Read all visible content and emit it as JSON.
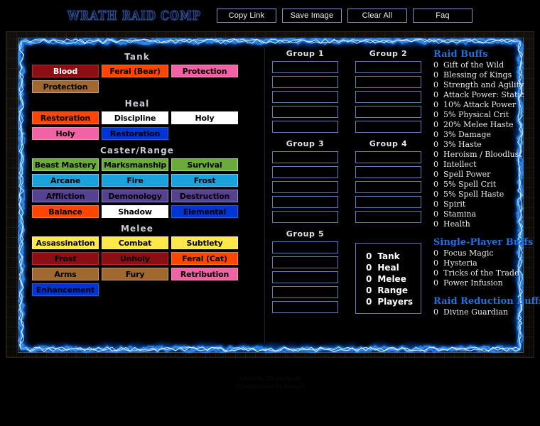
{
  "app": {
    "title": "WRATH RAID COMP",
    "accent_blue": "#1f6fe0",
    "border_blue": "#5f7fb5",
    "frame_gold": "#6b4f21"
  },
  "toolbar": {
    "buttons": [
      {
        "label": "Copy Link",
        "name": "copy-link-button"
      },
      {
        "label": "Save Image",
        "name": "save-image-button"
      },
      {
        "label": "Clear All",
        "name": "clear-all-button"
      },
      {
        "label": "Faq",
        "name": "faq-button"
      }
    ]
  },
  "specs": {
    "categories": [
      {
        "title": "Tank",
        "rows": [
          [
            {
              "label": "Blood",
              "bg": "#8b0f12",
              "fg": "#ffffff",
              "border": "#c41f3b"
            },
            {
              "label": "Feral (Bear)",
              "bg": "#ff4500",
              "fg": "#000000",
              "border": "#ff7d0a"
            },
            {
              "label": "Protection",
              "bg": "#f263a6",
              "fg": "#000000",
              "border": "#f58cba"
            }
          ],
          [
            {
              "label": "Protection",
              "bg": "#a0682f",
              "fg": "#000000",
              "border": "#c79c6e"
            }
          ]
        ]
      },
      {
        "title": "Heal",
        "rows": [
          [
            {
              "label": "Restoration",
              "bg": "#ff4500",
              "fg": "#000000",
              "border": "#ff7d0a"
            },
            {
              "label": "Discipline",
              "bg": "#ffffff",
              "fg": "#000000",
              "border": "#ffffff"
            },
            {
              "label": "Holy",
              "bg": "#ffffff",
              "fg": "#000000",
              "border": "#ffffff"
            }
          ],
          [
            {
              "label": "Holy",
              "bg": "#f263a6",
              "fg": "#000000",
              "border": "#f58cba"
            },
            {
              "label": "Restoration",
              "bg": "#0034d6",
              "fg": "#000000",
              "border": "#0070de"
            }
          ]
        ]
      },
      {
        "title": "Caster/Range",
        "rows": [
          [
            {
              "label": "Beast Mastery",
              "bg": "#6bab3c",
              "fg": "#000000",
              "border": "#abd473"
            },
            {
              "label": "Marksmanship",
              "bg": "#6bab3c",
              "fg": "#000000",
              "border": "#abd473"
            },
            {
              "label": "Survival",
              "bg": "#6bab3c",
              "fg": "#000000",
              "border": "#abd473"
            }
          ],
          [
            {
              "label": "Arcane",
              "bg": "#1ba1dd",
              "fg": "#000000",
              "border": "#69ccf0"
            },
            {
              "label": "Fire",
              "bg": "#1ba1dd",
              "fg": "#000000",
              "border": "#69ccf0"
            },
            {
              "label": "Frost",
              "bg": "#1ba1dd",
              "fg": "#000000",
              "border": "#69ccf0"
            }
          ],
          [
            {
              "label": "Affliction",
              "bg": "#55418f",
              "fg": "#000000",
              "border": "#9482c9"
            },
            {
              "label": "Demonology",
              "bg": "#55418f",
              "fg": "#000000",
              "border": "#9482c9"
            },
            {
              "label": "Destruction",
              "bg": "#55418f",
              "fg": "#000000",
              "border": "#9482c9"
            }
          ],
          [
            {
              "label": "Balance",
              "bg": "#ff4500",
              "fg": "#000000",
              "border": "#ff7d0a"
            },
            {
              "label": "Shadow",
              "bg": "#ffffff",
              "fg": "#000000",
              "border": "#ffffff"
            },
            {
              "label": "Elemental",
              "bg": "#0034d6",
              "fg": "#000000",
              "border": "#0070de"
            }
          ]
        ]
      },
      {
        "title": "Melee",
        "rows": [
          [
            {
              "label": "Assassination",
              "bg": "#ffe84a",
              "fg": "#000000",
              "border": "#fff569"
            },
            {
              "label": "Combat",
              "bg": "#ffe84a",
              "fg": "#000000",
              "border": "#fff569"
            },
            {
              "label": "Subtlety",
              "bg": "#ffe84a",
              "fg": "#000000",
              "border": "#fff569"
            }
          ],
          [
            {
              "label": "Frost",
              "bg": "#8b0f12",
              "fg": "#000000",
              "border": "#c41f3b"
            },
            {
              "label": "Unholy",
              "bg": "#8b0f12",
              "fg": "#000000",
              "border": "#c41f3b"
            },
            {
              "label": "Feral (Cat)",
              "bg": "#ff4500",
              "fg": "#000000",
              "border": "#ff7d0a"
            }
          ],
          [
            {
              "label": "Arms",
              "bg": "#a0682f",
              "fg": "#000000",
              "border": "#c79c6e"
            },
            {
              "label": "Fury",
              "bg": "#a0682f",
              "fg": "#000000",
              "border": "#c79c6e"
            },
            {
              "label": "Retribution",
              "bg": "#f263a6",
              "fg": "#000000",
              "border": "#f58cba"
            }
          ],
          [
            {
              "label": "Enhancement",
              "bg": "#0034d6",
              "fg": "#000000",
              "border": "#0070de"
            }
          ]
        ]
      }
    ]
  },
  "groups": {
    "slots_per_group": 5,
    "list": [
      {
        "label": "Group 1",
        "slots": [
          "",
          "",
          "",
          "",
          ""
        ]
      },
      {
        "label": "Group 2",
        "slots": [
          "",
          "",
          "",
          "",
          ""
        ]
      },
      {
        "label": "Group 3",
        "slots": [
          "",
          "",
          "",
          "",
          ""
        ]
      },
      {
        "label": "Group 4",
        "slots": [
          "",
          "",
          "",
          "",
          ""
        ]
      },
      {
        "label": "Group 5",
        "slots": [
          "",
          "",
          "",
          "",
          ""
        ]
      }
    ]
  },
  "counters": [
    {
      "count": "0",
      "label": "Tank"
    },
    {
      "count": "0",
      "label": "Heal"
    },
    {
      "count": "0",
      "label": "Melee"
    },
    {
      "count": "0",
      "label": "Range"
    },
    {
      "count": "0",
      "label": "Players"
    }
  ],
  "buffs": {
    "sections": [
      {
        "title": "Raid Buffs",
        "items": [
          {
            "count": "0",
            "label": "Gift of the Wild"
          },
          {
            "count": "0",
            "label": "Blessing of Kings"
          },
          {
            "count": "0",
            "label": "Strength and Agility"
          },
          {
            "count": "0",
            "label": "Attack Power: Static"
          },
          {
            "count": "0",
            "label": "10% Attack Power"
          },
          {
            "count": "0",
            "label": "5% Physical Crit"
          },
          {
            "count": "0",
            "label": "20% Melee Haste"
          },
          {
            "count": "0",
            "label": "3% Damage"
          },
          {
            "count": "0",
            "label": "3% Haste"
          },
          {
            "count": "0",
            "label": "Heroism / Bloodlust"
          },
          {
            "count": "0",
            "label": "Intellect"
          },
          {
            "count": "0",
            "label": "Spell Power"
          },
          {
            "count": "0",
            "label": "5% Spell Crit"
          },
          {
            "count": "0",
            "label": "5% Spell Haste"
          },
          {
            "count": "0",
            "label": "Spirit"
          },
          {
            "count": "0",
            "label": "Stamina"
          },
          {
            "count": "0",
            "label": "Health"
          }
        ]
      },
      {
        "title": "Single-Player Buffs",
        "items": [
          {
            "count": "0",
            "label": "Focus Magic"
          },
          {
            "count": "0",
            "label": "Hysteria"
          },
          {
            "count": "0",
            "label": "Tricks of the Trade"
          },
          {
            "count": "0",
            "label": "Power Infusion"
          }
        ]
      },
      {
        "title": "Raid Reduction Buffs",
        "items": [
          {
            "count": "0",
            "label": "Divine Guardian"
          }
        ]
      }
    ]
  },
  "footer": {
    "line1": "Made by Darya Atsali",
    "line2": "Contributions by Nelaya"
  }
}
